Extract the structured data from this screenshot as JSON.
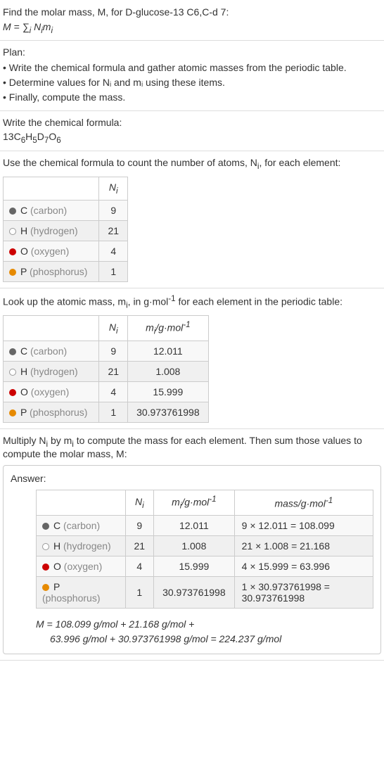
{
  "intro": {
    "line1": "Find the molar mass, M, for D-glucose-13 C6,C-d 7:",
    "formula_html": "M = ∑<sub>i</sub> N<sub>i</sub>m<sub>i</sub>"
  },
  "plan": {
    "title": "Plan:",
    "items": [
      "• Write the chemical formula and gather atomic masses from the periodic table.",
      "• Determine values for Nᵢ and mᵢ using these items.",
      "• Finally, compute the mass."
    ]
  },
  "chemformula": {
    "title": "Write the chemical formula:",
    "value_html": "13C<sub>6</sub>H<sub>5</sub>D<sub>7</sub>O<sub>6</sub>"
  },
  "count": {
    "title_html": "Use the chemical formula to count the number of atoms, N<sub>i</sub>, for each element:",
    "header_ni_html": "N<sub>i</sub>",
    "rows": [
      {
        "dot": "dot-c",
        "sym": "C",
        "name": "(carbon)",
        "ni": "9"
      },
      {
        "dot": "dot-h",
        "sym": "H",
        "name": "(hydrogen)",
        "ni": "21"
      },
      {
        "dot": "dot-o",
        "sym": "O",
        "name": "(oxygen)",
        "ni": "4"
      },
      {
        "dot": "dot-p",
        "sym": "P",
        "name": "(phosphorus)",
        "ni": "1"
      }
    ]
  },
  "lookup": {
    "title_html": "Look up the atomic mass, m<sub>i</sub>, in g·mol<sup>-1</sup> for each element in the periodic table:",
    "header_ni_html": "N<sub>i</sub>",
    "header_mi_html": "m<sub>i</sub>/g·mol<sup>-1</sup>",
    "rows": [
      {
        "dot": "dot-c",
        "sym": "C",
        "name": "(carbon)",
        "ni": "9",
        "mi": "12.011"
      },
      {
        "dot": "dot-h",
        "sym": "H",
        "name": "(hydrogen)",
        "ni": "21",
        "mi": "1.008"
      },
      {
        "dot": "dot-o",
        "sym": "O",
        "name": "(oxygen)",
        "ni": "4",
        "mi": "15.999"
      },
      {
        "dot": "dot-p",
        "sym": "P",
        "name": "(phosphorus)",
        "ni": "1",
        "mi": "30.973761998"
      }
    ]
  },
  "multiply": {
    "title_html": "Multiply N<sub>i</sub> by m<sub>i</sub> to compute the mass for each element. Then sum those values to compute the molar mass, M:"
  },
  "answer": {
    "label": "Answer:",
    "header_ni_html": "N<sub>i</sub>",
    "header_mi_html": "m<sub>i</sub>/g·mol<sup>-1</sup>",
    "header_mass_html": "mass/g·mol<sup>-1</sup>",
    "rows": [
      {
        "dot": "dot-c",
        "sym": "C",
        "name": "(carbon)",
        "ni": "9",
        "mi": "12.011",
        "mass": "9 × 12.011 = 108.099"
      },
      {
        "dot": "dot-h",
        "sym": "H",
        "name": "(hydrogen)",
        "ni": "21",
        "mi": "1.008",
        "mass": "21 × 1.008 = 21.168"
      },
      {
        "dot": "dot-o",
        "sym": "O",
        "name": "(oxygen)",
        "ni": "4",
        "mi": "15.999",
        "mass": "4 × 15.999 = 63.996"
      },
      {
        "dot": "dot-p",
        "sym": "P",
        "name": "(phosphorus)",
        "ni": "1",
        "mi": "30.973761998",
        "mass": "1 × 30.973761998 = 30.973761998"
      }
    ],
    "result_line1": "M = 108.099 g/mol + 21.168 g/mol +",
    "result_line2": "63.996 g/mol + 30.973761998 g/mol = 224.237 g/mol"
  }
}
